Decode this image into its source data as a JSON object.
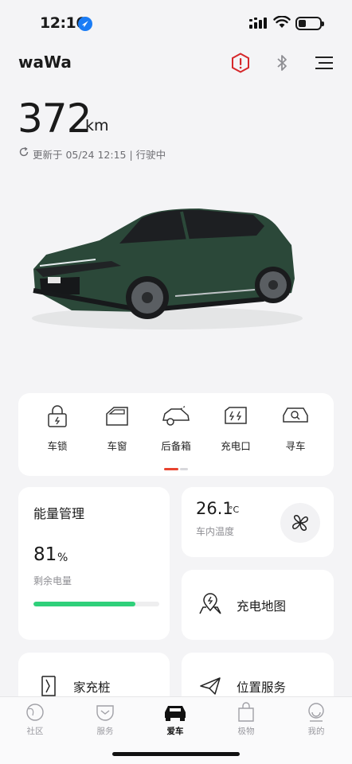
{
  "status_bar": {
    "time": "12:16"
  },
  "header": {
    "vehicle_name": "waWa"
  },
  "range": {
    "value": "372",
    "unit": "km"
  },
  "update": {
    "text": "更新于 05/24 12:15 | 行驶中"
  },
  "controls": [
    {
      "label": "车锁",
      "icon": "lock-icon"
    },
    {
      "label": "车窗",
      "icon": "window-icon"
    },
    {
      "label": "后备箱",
      "icon": "trunk-icon"
    },
    {
      "label": "充电口",
      "icon": "charge-port-icon"
    },
    {
      "label": "寻车",
      "icon": "find-car-icon"
    }
  ],
  "energy": {
    "title": "能量管理",
    "soc_value": "81",
    "soc_unit": "%",
    "soc_label": "剩余电量",
    "soc_fraction": 0.81,
    "bar_color": "#2fd07a"
  },
  "climate": {
    "temp_value": "26.1",
    "temp_unit": "°C",
    "temp_label": "车内温度"
  },
  "services": {
    "charge_map": "充电地图",
    "home_charger": "家充桩",
    "location": "位置服务"
  },
  "tabs": [
    {
      "label": "社区",
      "icon": "community-icon",
      "active": false
    },
    {
      "label": "服务",
      "icon": "service-icon",
      "active": false
    },
    {
      "label": "爱车",
      "icon": "car-icon",
      "active": true
    },
    {
      "label": "极物",
      "icon": "shop-bag-icon",
      "active": false
    },
    {
      "label": "我的",
      "icon": "profile-icon",
      "active": false
    }
  ],
  "colors": {
    "accent_red": "#e8432f",
    "alert_red": "#d6282b",
    "car_body": "#2c4a3a"
  }
}
